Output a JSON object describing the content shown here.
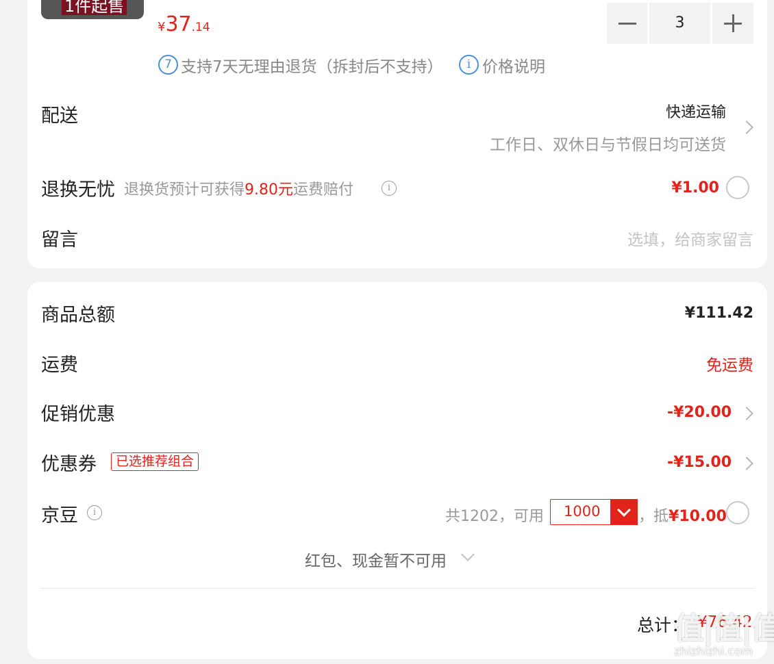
{
  "product": {
    "min_purchase_badge": "1件起售",
    "price_symbol": "¥",
    "price_int": "37",
    "price_dec": ".14",
    "quantity": "3",
    "return_policy": "支持7天无理由退货（拆封后不支持）",
    "return_icon_text": "7",
    "price_info_label": "价格说明",
    "info_icon_text": "i"
  },
  "delivery": {
    "label": "配送",
    "method": "快递运输",
    "note": "工作日、双休日与节假日均可送货"
  },
  "return_insurance": {
    "label": "退换无忧",
    "desc_prefix": "退换货预计可获得",
    "desc_amount": "9.80元",
    "desc_suffix": "运费赔付",
    "price": "¥1.00"
  },
  "message": {
    "label": "留言",
    "placeholder": "选填，给商家留言"
  },
  "summary": {
    "subtotal_label": "商品总额",
    "subtotal_value": "¥111.42",
    "shipping_label": "运费",
    "shipping_value": "免运费",
    "promo_label": "促销优惠",
    "promo_value": "-¥20.00",
    "coupon_label": "优惠券",
    "coupon_badge": "已选推荐组合",
    "coupon_value": "-¥15.00",
    "beans_label": "京豆",
    "beans_total": "共1202，可用",
    "beans_selected": "1000",
    "beans_comma": "，",
    "beans_offset_prefix": "抵",
    "beans_offset_value": "¥10.00",
    "unavailable_note": "红包、现金暂不可用",
    "total_label": "总计：",
    "total_value": "¥76.42"
  },
  "watermark": {
    "logo_text": "值|值|值",
    "domain": "zhizhizhi.com"
  },
  "colors": {
    "accent": "#e2231a",
    "info_blue": "#4a90d9",
    "background": "#f2f2f2"
  }
}
